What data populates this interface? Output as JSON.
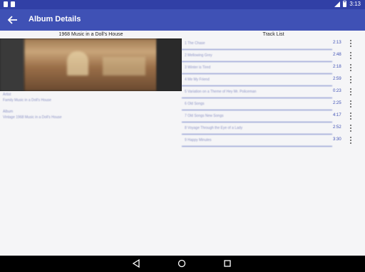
{
  "status_bar": {
    "time": "3:13"
  },
  "app_bar": {
    "title": "Album Details",
    "back_icon": "arrow-back-icon"
  },
  "album": {
    "name": "1968 Music in a Doll's House",
    "artist_label": "Artist",
    "artist_value": "Family Music in a Doll's House",
    "album_label": "Album",
    "album_value": "Vintage 1968 Music in a Doll's House"
  },
  "track_list": {
    "header": "Track List",
    "tracks": [
      {
        "name": "1 The Chase",
        "duration": "2:13"
      },
      {
        "name": "2 Mellowing Grey",
        "duration": "2:48"
      },
      {
        "name": "3 Winter is Tired",
        "duration": "2:18"
      },
      {
        "name": "4 Me My Friend",
        "duration": "2:59"
      },
      {
        "name": "5 Variation on a Theme of Hey Mr. Policeman",
        "duration": "0:23"
      },
      {
        "name": "6 Old Songs",
        "duration": "2:25"
      },
      {
        "name": "7 Old Songs New Songs",
        "duration": "4:17"
      },
      {
        "name": "8 Voyage Through the Eye of a Lady",
        "duration": "2:52"
      },
      {
        "name": "9 Happy Minutes",
        "duration": "3:30"
      }
    ]
  },
  "colors": {
    "primary": "#3f51b5",
    "primary_dark": "#3140a6",
    "background": "#f5f5f7"
  }
}
